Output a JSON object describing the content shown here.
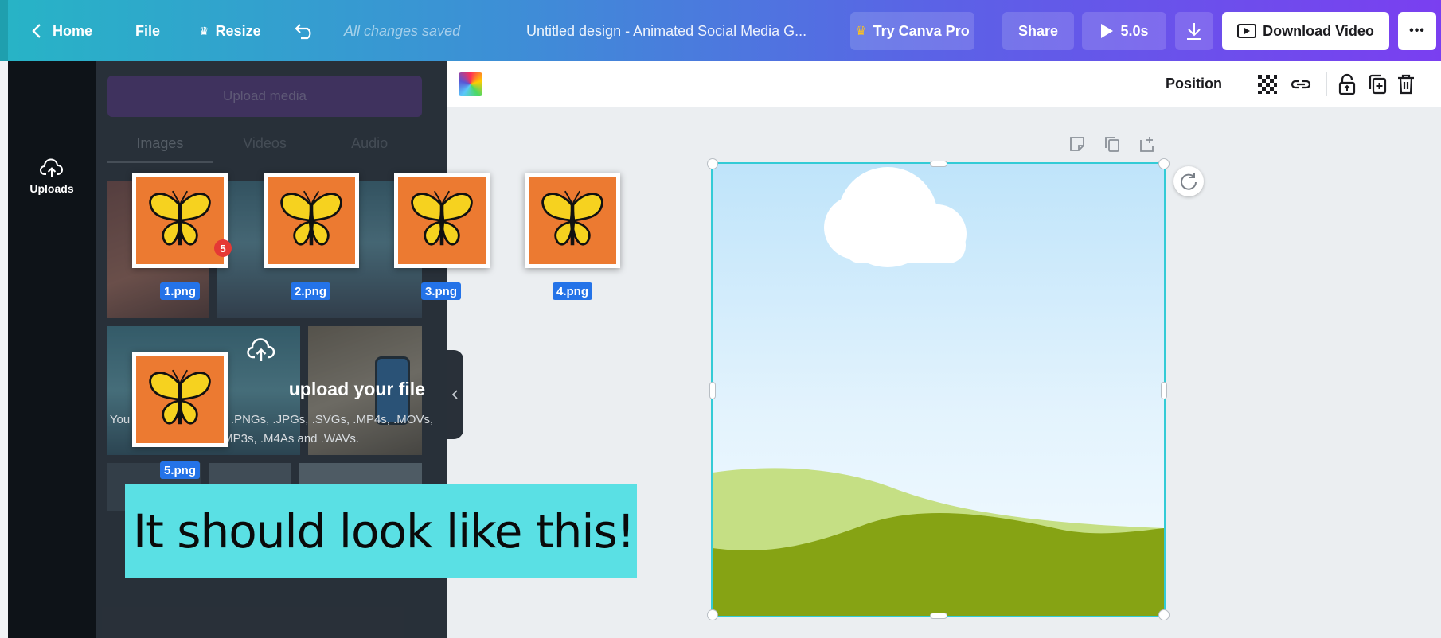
{
  "topbar": {
    "home_label": "Home",
    "file_label": "File",
    "resize_label": "Resize",
    "saved_status": "All changes saved",
    "document_title": "Untitled design - Animated Social Media G...",
    "try_pro_label": "Try Canva Pro",
    "share_label": "Share",
    "duration_label": "5.0s",
    "download_video_label": "Download Video",
    "more_label": "•••"
  },
  "rail": {
    "uploads_label": "Uploads"
  },
  "panel": {
    "upload_button": "Upload media",
    "tabs": [
      {
        "label": "Images",
        "active": true
      },
      {
        "label": "Videos",
        "active": false
      },
      {
        "label": "Audio",
        "active": false
      }
    ],
    "drop_title": "Drag media here to upload your file",
    "drop_title_visible": "upload your file",
    "drop_sub_line1": "You can upload image .PNGs, .JPGs, .SVGs, .MP4s, .MOVs,",
    "drop_sub_line2": ".GIFs, .MP3s, .M4As and .WAVs."
  },
  "dragged_files": [
    {
      "label": "1.png",
      "badge": "5"
    },
    {
      "label": "2.png"
    },
    {
      "label": "3.png"
    },
    {
      "label": "4.png"
    },
    {
      "label": "5.png"
    }
  ],
  "context_toolbar": {
    "position_label": "Position"
  },
  "caption": {
    "text": "It should look like this!"
  },
  "colors": {
    "selection": "#33cbd6",
    "tile_orange": "#ec7a31",
    "label_blue": "#2473e8",
    "caption_bg": "#5ae0e4",
    "hill_light": "#c5df84",
    "hill_dark": "#86a314"
  }
}
